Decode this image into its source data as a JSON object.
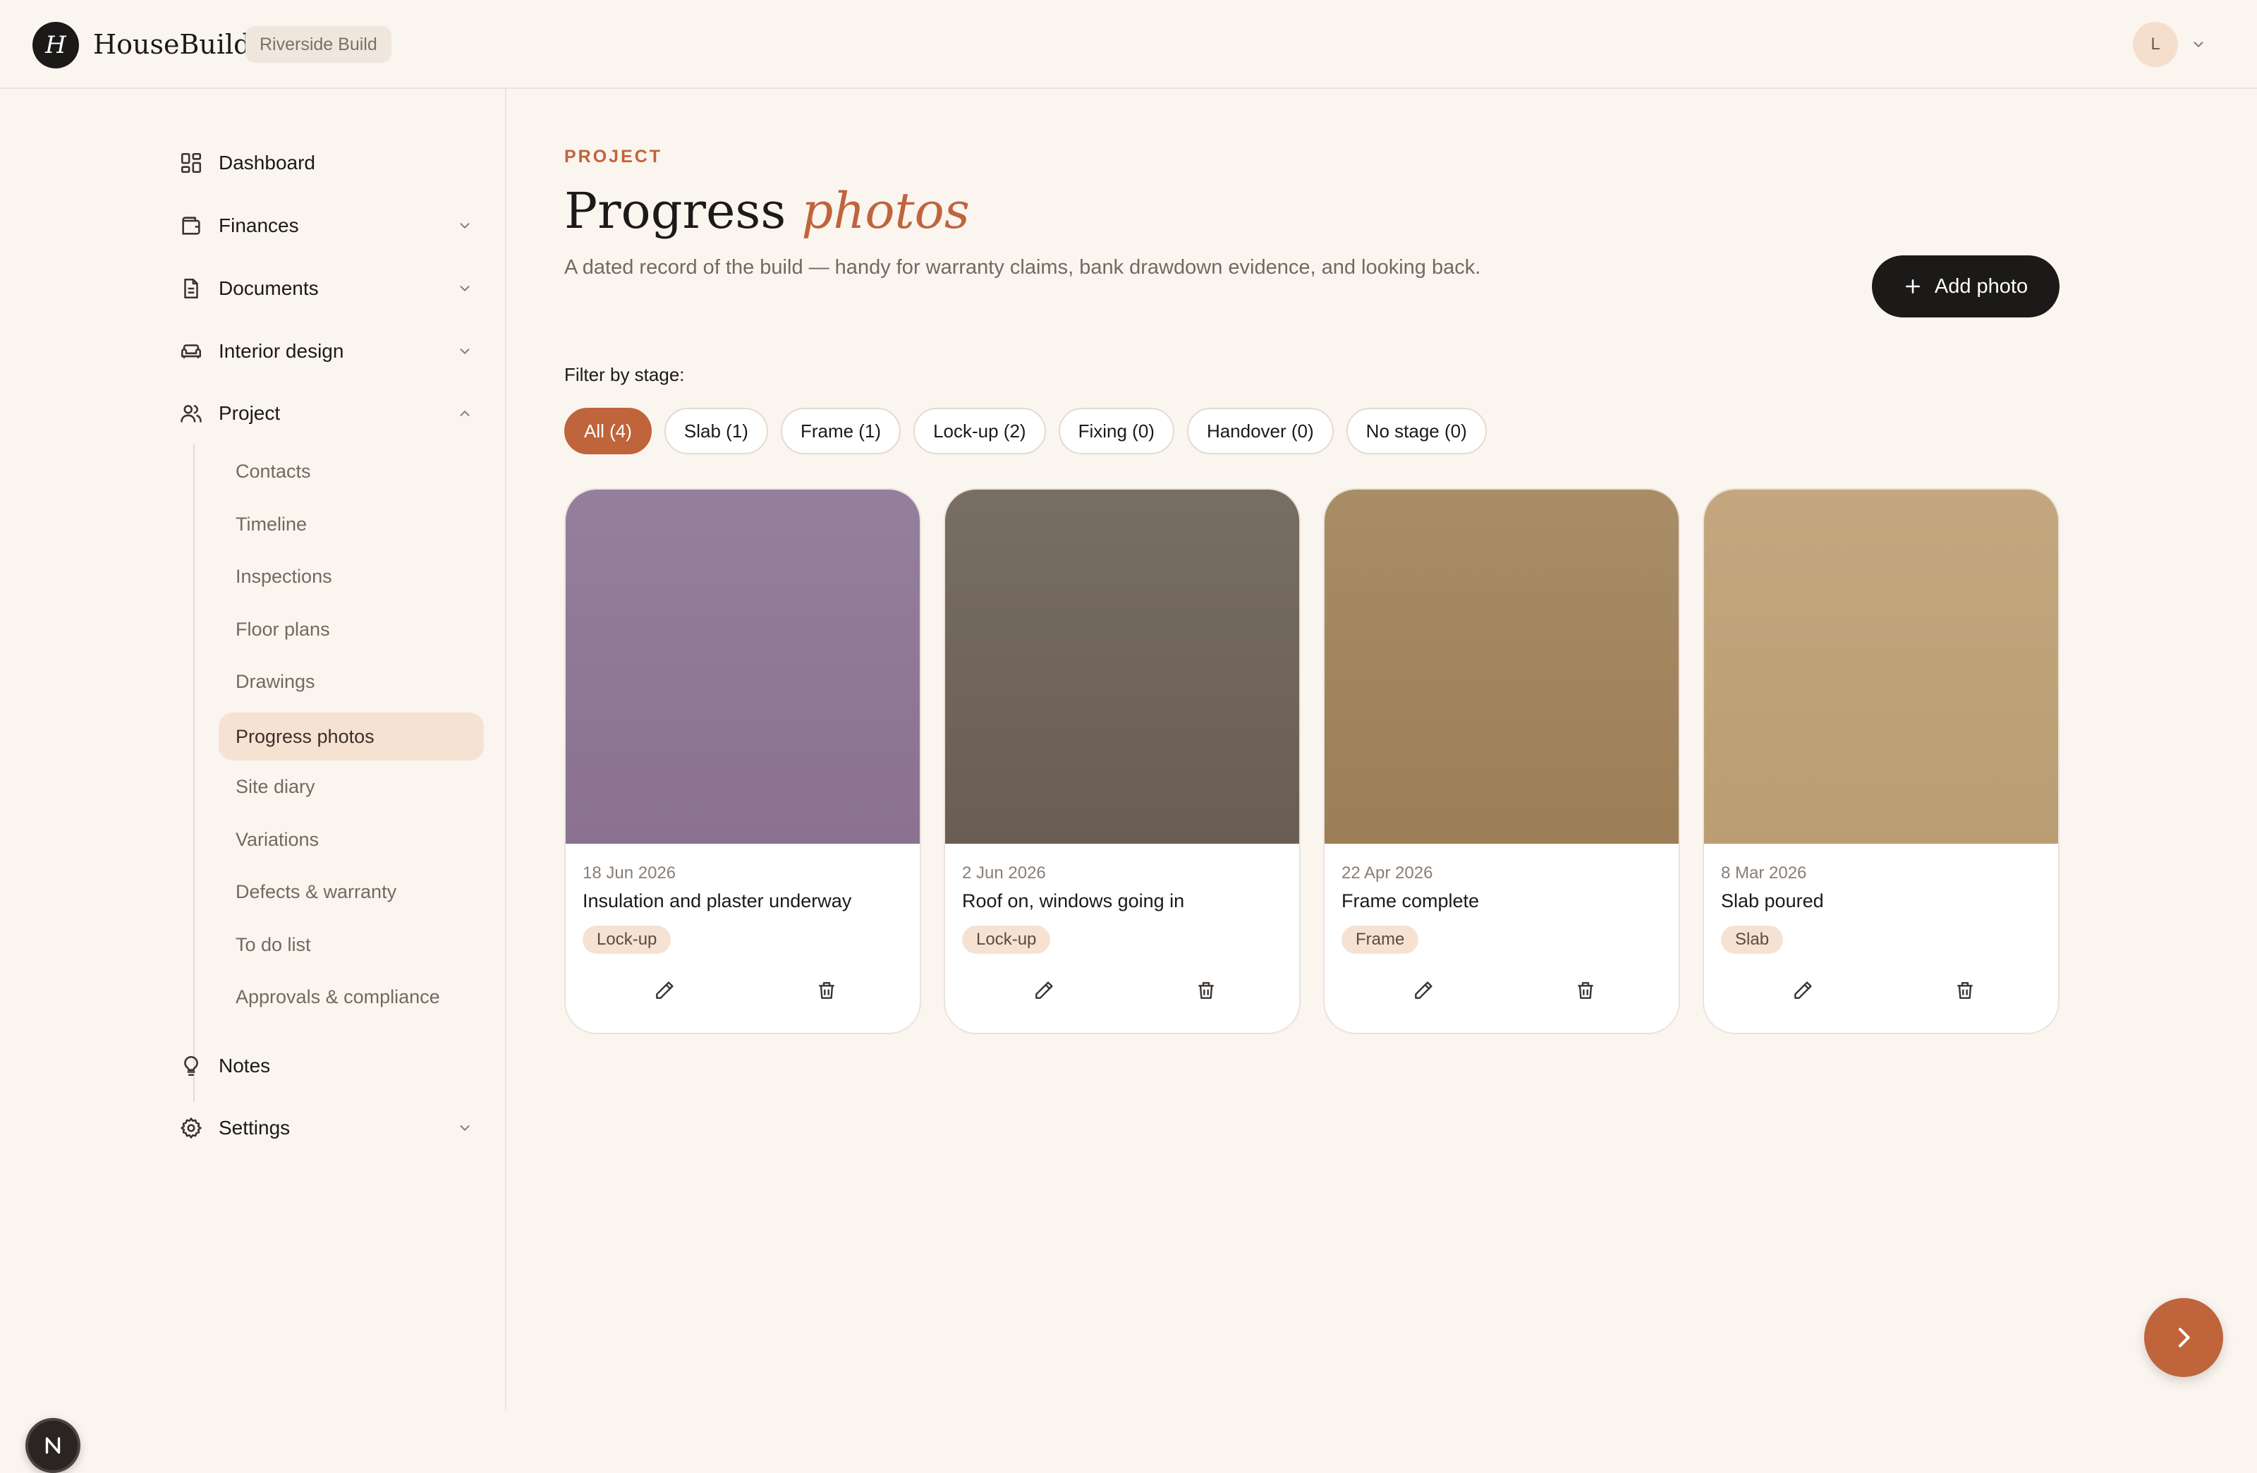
{
  "header": {
    "logo_letter": "H",
    "brand": "HouseBuild",
    "project": "Riverside Build",
    "avatar_initial": "L"
  },
  "sidebar": {
    "items": [
      {
        "label": "Dashboard",
        "icon": "grid-icon"
      },
      {
        "label": "Finances",
        "icon": "wallet-icon"
      },
      {
        "label": "Documents",
        "icon": "document-icon"
      },
      {
        "label": "Interior design",
        "icon": "sofa-icon"
      },
      {
        "label": "Project",
        "icon": "users-icon"
      },
      {
        "label": "Notes",
        "icon": "lightbulb-icon"
      },
      {
        "label": "Settings",
        "icon": "gear-icon"
      }
    ],
    "project_sub": [
      "Contacts",
      "Timeline",
      "Inspections",
      "Floor plans",
      "Drawings",
      "Progress photos",
      "Site diary",
      "Variations",
      "Defects & warranty",
      "To do list",
      "Approvals & compliance"
    ],
    "active_sub": "Progress photos"
  },
  "main": {
    "eyebrow": "PROJECT",
    "title_main": "Progress",
    "title_accent": "photos",
    "subtitle": "A dated record of the build — handy for warranty claims, bank drawdown evidence, and looking back.",
    "add_button": "Add photo",
    "filter_label": "Filter by stage:",
    "filters": [
      "All (4)",
      "Slab (1)",
      "Frame (1)",
      "Lock-up (2)",
      "Fixing (0)",
      "Handover (0)",
      "No stage (0)"
    ],
    "photos": [
      {
        "date": "18 Jun 2026",
        "caption": "Insulation and plaster underway",
        "stage": "Lock-up",
        "color_top": "#947f9d",
        "color_bottom": "#8a7290"
      },
      {
        "date": "2 Jun 2026",
        "caption": "Roof on, windows going in",
        "stage": "Lock-up",
        "color_top": "#786e64",
        "color_bottom": "#6a5d54"
      },
      {
        "date": "22 Apr 2026",
        "caption": "Frame complete",
        "stage": "Frame",
        "color_top": "#a88d66",
        "color_bottom": "#9c7e57"
      },
      {
        "date": "8 Mar 2026",
        "caption": "Slab poured",
        "stage": "Slab",
        "color_top": "#c4a77e",
        "color_bottom": "#bb9d73"
      }
    ]
  },
  "colors": {
    "accent": "#c0643c",
    "background": "#faf5ef",
    "dark": "#1c1a18"
  }
}
